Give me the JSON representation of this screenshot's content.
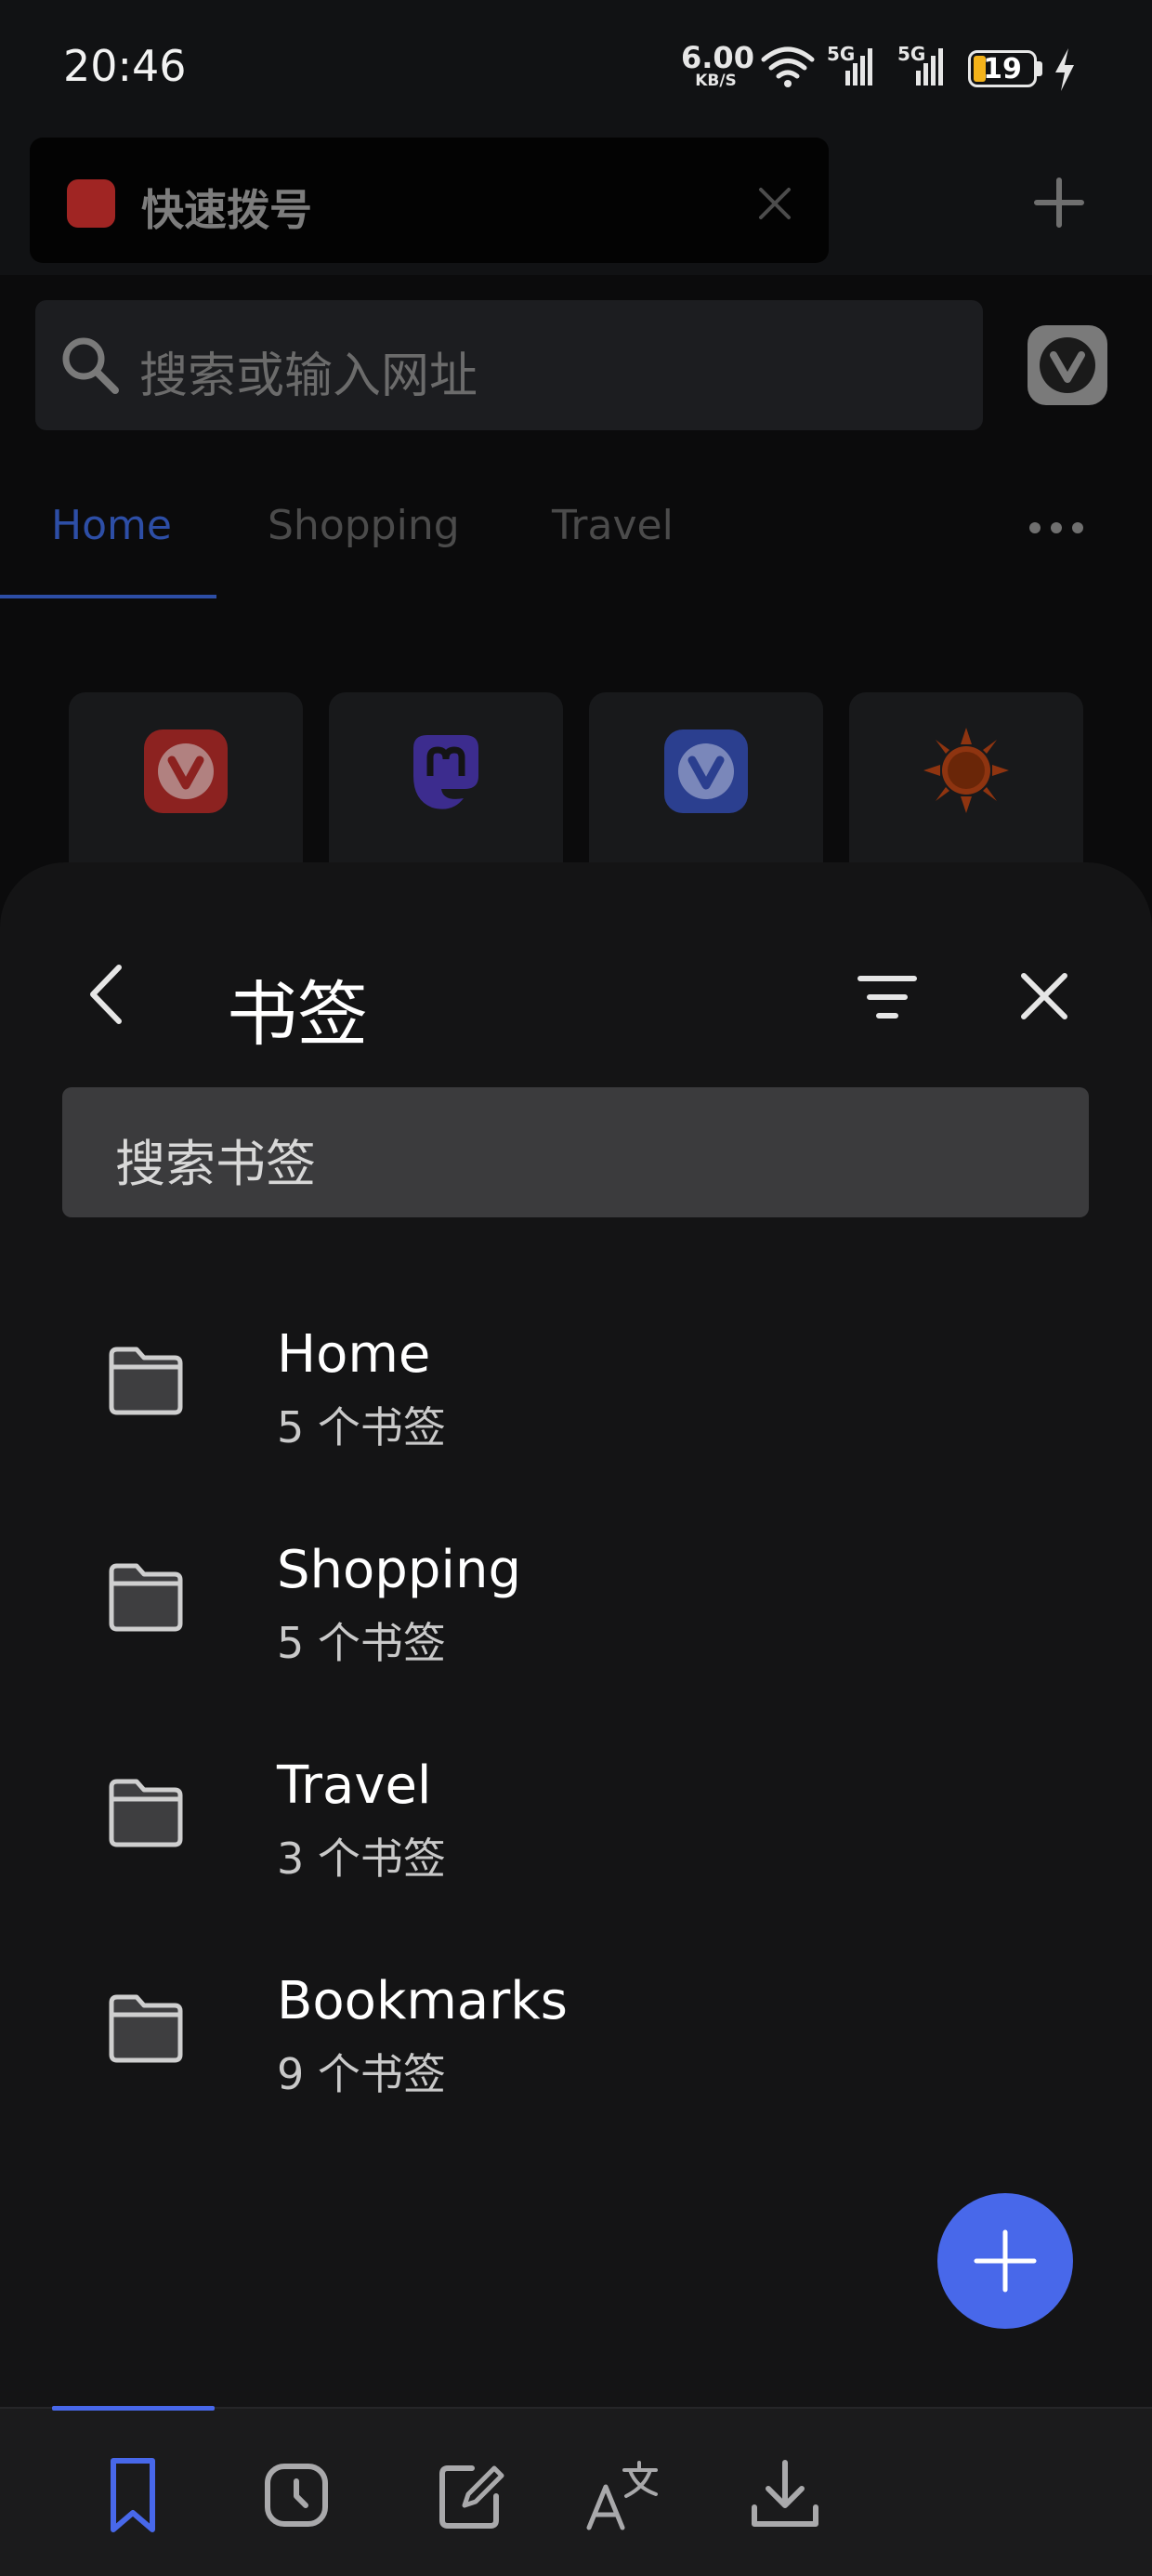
{
  "status_bar": {
    "time": "20:46",
    "net_speed_value": "6.00",
    "net_speed_unit": "KB/S",
    "signal_1_label": "5G",
    "signal_2_label": "5G",
    "battery_level": "19",
    "battery_color": "#f3b21a",
    "icons": [
      "wifi-icon",
      "signal-icon",
      "signal-icon",
      "battery-icon",
      "charging-icon"
    ]
  },
  "browser": {
    "tab_title": "快速拨号",
    "address_placeholder": "搜索或输入网址",
    "speed_dial_tabs": [
      "Home",
      "Shopping",
      "Travel"
    ],
    "active_speed_dial_tab": "Home",
    "speed_dial_tiles": [
      {
        "icon": "vivaldi-icon",
        "color": "#d6312f"
      },
      {
        "icon": "mastodon-icon",
        "color": "#5a3fd6"
      },
      {
        "icon": "vivaldi-icon",
        "color": "#3b5bd9"
      },
      {
        "icon": "sun-icon",
        "color": "#e0501a"
      }
    ]
  },
  "bookmarks_panel": {
    "title": "书签",
    "search_placeholder": "搜索书签",
    "folders": [
      {
        "name": "Home",
        "count": "5 个书签"
      },
      {
        "name": "Shopping",
        "count": "5 个书签"
      },
      {
        "name": "Travel",
        "count": "3 个书签"
      },
      {
        "name": "Bookmarks",
        "count": "9 个书签"
      }
    ],
    "accent_color": "#4868ea"
  },
  "bottom_nav": {
    "items": [
      "bookmark-icon",
      "history-icon",
      "notes-icon",
      "translate-icon",
      "download-icon"
    ],
    "active_item": "bookmark-icon"
  }
}
